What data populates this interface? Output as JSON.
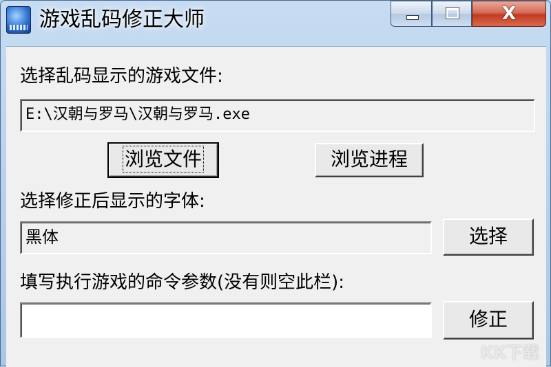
{
  "window": {
    "title": "游戏乱码修正大师",
    "icon": "app-icon",
    "close_glyph": "X"
  },
  "game_file": {
    "label": "选择乱码显示的游戏文件:",
    "path": "E:\\汉朝与罗马\\汉朝与罗马.exe"
  },
  "buttons": {
    "browse_file": "浏览文件",
    "browse_process": "浏览进程",
    "select_font": "选择",
    "fix": "修正"
  },
  "font": {
    "label": "选择修正后显示的字体:",
    "value": "黑体"
  },
  "command": {
    "label": "填写执行游戏的命令参数(没有则空此栏):",
    "value": ""
  },
  "watermark": "KK下载",
  "colors": {
    "titlebar": "#b9d1ea",
    "client": "#f0f0f0",
    "close_button": "#c23b21"
  }
}
